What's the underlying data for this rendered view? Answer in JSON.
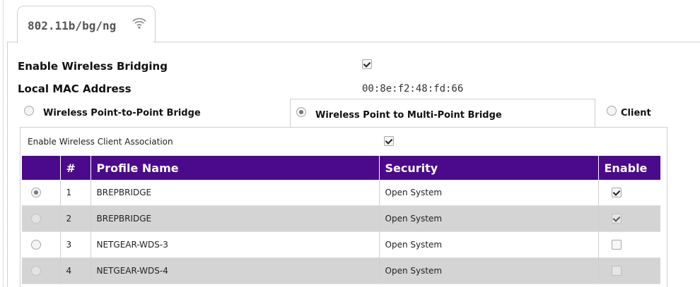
{
  "tab": {
    "label": "802.11b/bg/ng",
    "icon": "wifi-icon"
  },
  "settings": {
    "enable_bridging_label": "Enable Wireless Bridging",
    "enable_bridging_checked": true,
    "mac_label": "Local MAC Address",
    "mac_value": "00:8e:f2:48:fd:66"
  },
  "modes": [
    {
      "label": "Wireless Point-to-Point Bridge",
      "selected": false
    },
    {
      "label": "Wireless Point to Multi-Point Bridge",
      "selected": true
    },
    {
      "label": "Client",
      "selected": false
    }
  ],
  "client_association": {
    "label": "Enable Wireless Client Association",
    "checked": true
  },
  "table": {
    "headers": {
      "select": "",
      "num": "#",
      "profile": "Profile Name",
      "security": "Security",
      "enable": "Enable"
    },
    "header_color": "#4b0a8c",
    "rows": [
      {
        "num": "1",
        "profile": "BREPBRIDGE",
        "security": "Open System",
        "selected": true,
        "enabled": true,
        "disabled": false
      },
      {
        "num": "2",
        "profile": "BREPBRIDGE",
        "security": "Open System",
        "selected": false,
        "enabled": true,
        "disabled": true
      },
      {
        "num": "3",
        "profile": "NETGEAR-WDS-3",
        "security": "Open System",
        "selected": false,
        "enabled": false,
        "disabled": false
      },
      {
        "num": "4",
        "profile": "NETGEAR-WDS-4",
        "security": "Open System",
        "selected": false,
        "enabled": false,
        "disabled": true
      }
    ]
  }
}
